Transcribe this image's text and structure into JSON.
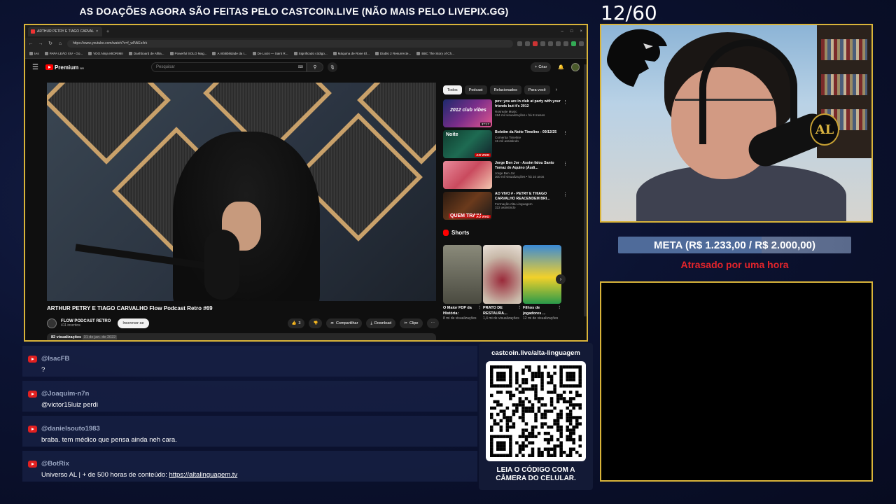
{
  "banner": "AS DOAÇÕES AGORA SÃO FEITAS PELO CASTCOIN.LIVE (NÃO MAIS PELO LIVEPIX.GG)",
  "counter": "12/60",
  "browser": {
    "tab_title": "ARTHUR PETRY E TIAGO CARVAL",
    "url": "https://www.youtube.com/watch?v=f_wPAiEs4rk",
    "bookmarks": [
      "IAs",
      "PAPA LEÃO XIV - Go...",
      "VDO.Ninja MIORIMII",
      "Dashboard de Afilia...",
      "Powerful SOLO Mag...",
      "A infalibilidade da I...",
      "De Locis — Saint R...",
      "Significado código...",
      "Máquina de Rose El...",
      "Diablo 2 Resurrecte...",
      "BBC The Story of Ch..."
    ]
  },
  "youtube": {
    "logo": "Premium",
    "logo_sup": "BR",
    "search_placeholder": "Pesquisar",
    "create": "Criar",
    "video_title": "ARTHUR PETRY E TIAGO CARVALHO Flow Podcast Retro #69",
    "channel_name": "FLOW PODCAST RETRO",
    "channel_subs": "411 inscritos",
    "subscribe": "Inscrever-se",
    "likes": "3",
    "share": "Compartilhar",
    "download": "Download",
    "clip": "Clipe",
    "views": "82 visualizações",
    "date": "31 de jan. de 2022",
    "chips": [
      "Todos",
      "Podcast",
      "Relacionados",
      "Para você"
    ],
    "recommendations": [
      {
        "title": "pov: you are in club at party with your friends but it's 2012",
        "channel": "Rosreale Music",
        "meta": "194 mil visualizações • há 8 meses",
        "badge": "37:17",
        "thumb_text": "2012 club vibes"
      },
      {
        "title": "Boletim da Noite Timeline - 09/12/25",
        "channel": "Comenta Timeline",
        "meta": "15 mil assistindo",
        "badge": "AO VIVO",
        "thumb_text": "Noite"
      },
      {
        "title": "Jorge Ben Jor - Assim falou Santo Tomaz de Aquino (Áudi...",
        "channel": "Jorge Ben Jor",
        "meta": "300 mil visualizações • há 10 anos",
        "badge": "",
        "thumb_text": ""
      },
      {
        "title": "AO VIVO # - PETRY E THIAGO CARVALHO REACENDEM BRI...",
        "channel": "Formação Alta Linguagem",
        "meta": "322 assistindo",
        "badge": "AO VIVO",
        "thumb_text": "QUEM TRAIU"
      }
    ],
    "shorts_label": "Shorts",
    "shorts": [
      {
        "title": "O Maior FDP da História:",
        "meta": "8 mi de visualizações"
      },
      {
        "title": "PRATO DE RESTAURA...",
        "meta": "1,4 mi de visualizações"
      },
      {
        "title": "Filhos de jogadores ...",
        "meta": "12 mi de visualizações"
      }
    ]
  },
  "webcam": {
    "badge": "AL"
  },
  "goal": {
    "text": "META (R$ 1.233,00 / R$ 2.000,00)",
    "progress": 0.6165,
    "status": "Atrasado por uma hora",
    "status_color": "#e3242b"
  },
  "chat": [
    {
      "user": "@IsacFB",
      "text": "?"
    },
    {
      "user": "@Joaquim-n7n",
      "text": "@victor15luiz perdi"
    },
    {
      "user": "@danielsouto1983",
      "text": "braba. tem médico que pensa ainda neh cara."
    },
    {
      "user": "@BotRix",
      "text": "Universo AL | + de 500 horas de conteúdo: ",
      "link": "https://altalinguagem.tv"
    }
  ],
  "qr": {
    "url": "castcoin.live/alta-linguagem",
    "caption_line1": "LEIA O CÓDIGO COM A",
    "caption_line2": "CÂMERA DO CELULAR."
  },
  "colors": {
    "frame": "#d9b43a",
    "youtube_red": "#ff0000",
    "background": "#0c1332"
  }
}
